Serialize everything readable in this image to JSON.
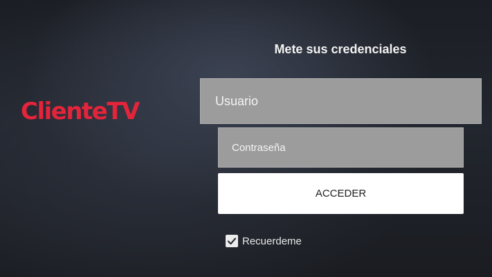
{
  "brand": {
    "logo_text": "ClienteTV",
    "logo_color": "#e4243b"
  },
  "login": {
    "heading": "Mete sus credenciales",
    "username_placeholder": "Usuario",
    "password_placeholder": "Contraseña",
    "submit_label": "ACCEDER",
    "remember_label": "Recuerdeme",
    "remember_checked": true
  },
  "icons": {
    "checkbox": "checkmark-icon"
  }
}
